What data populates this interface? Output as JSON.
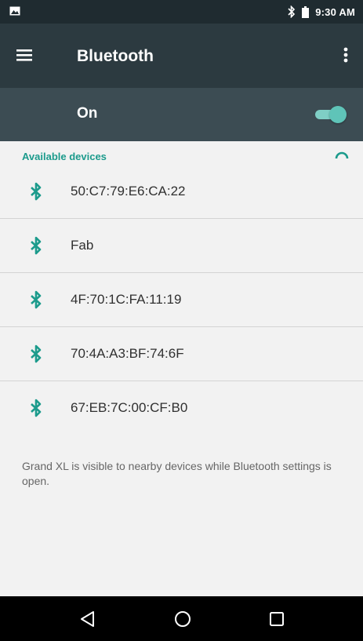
{
  "status_bar": {
    "time": "9:30 AM",
    "icons": [
      "image-notification-icon",
      "bluetooth-icon",
      "battery-icon"
    ]
  },
  "toolbar": {
    "title": "Bluetooth",
    "menu_icon": "hamburger-menu-icon",
    "overflow_icon": "more-vert-icon"
  },
  "master_switch": {
    "label": "On",
    "checked": true
  },
  "devices": {
    "header": "Available devices",
    "items": [
      {
        "name": "50:C7:79:E6:CA:22"
      },
      {
        "name": "Fab"
      },
      {
        "name": "4F:70:1C:FA:11:19"
      },
      {
        "name": "70:4A:A3:BF:74:6F"
      },
      {
        "name": "67:EB:7C:00:CF:B0"
      }
    ]
  },
  "footer_note": "Grand XL is visible to nearby devices while Bluetooth settings is open.",
  "nav_bar": {
    "buttons": [
      "back-icon",
      "home-icon",
      "recents-icon"
    ]
  },
  "colors": {
    "accent": "#1c9b8c",
    "toolbar": "#2c3a40",
    "switch_bar": "#3c4c53",
    "status_bar": "#1f2b30"
  }
}
